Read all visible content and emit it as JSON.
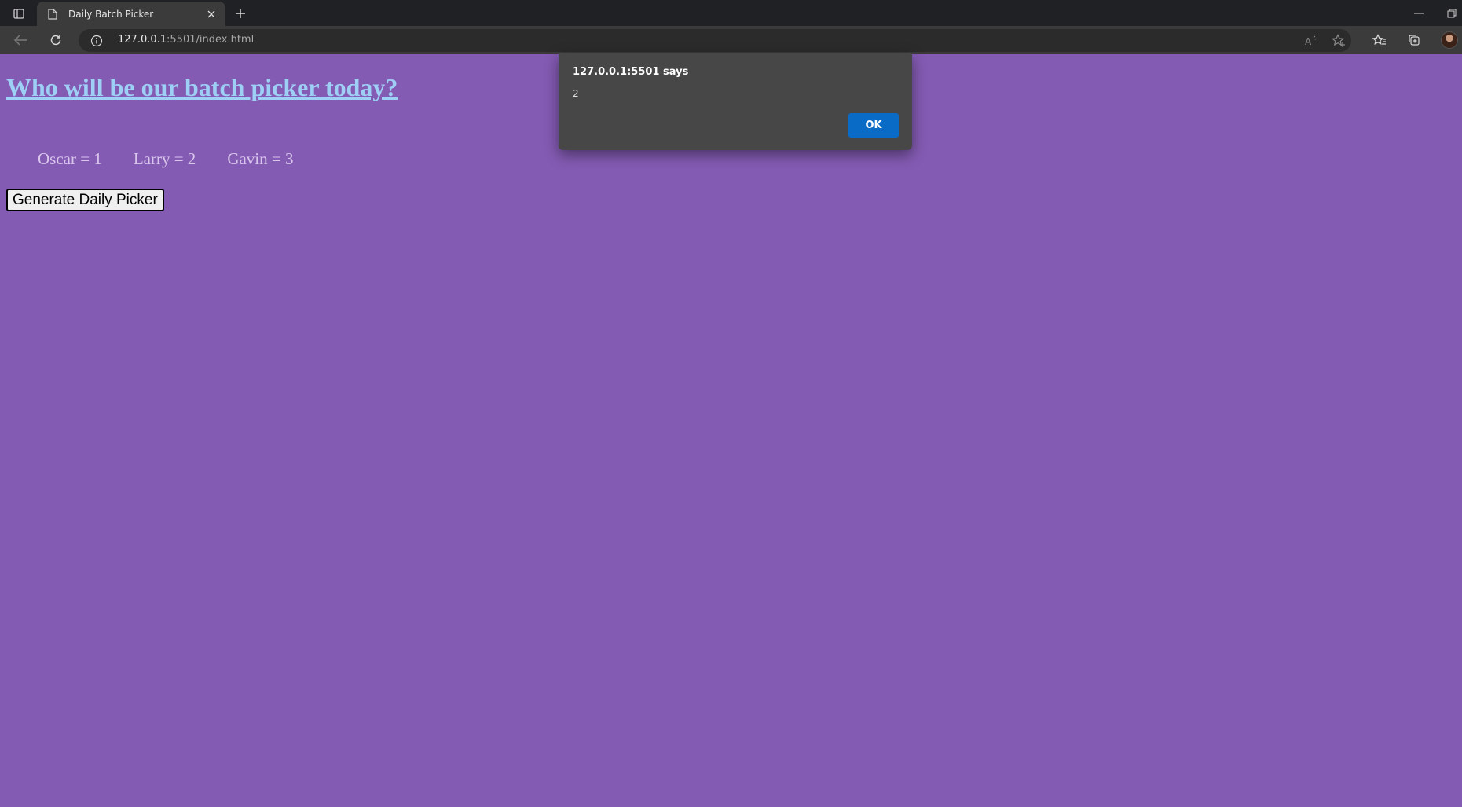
{
  "browser": {
    "tab": {
      "title": "Daily Batch Picker"
    },
    "address": {
      "host": "127.0.0.1",
      "rest": ":5501/index.html"
    },
    "icons": {
      "tab_actions": "tab-actions-icon",
      "page_favicon": "page-icon",
      "tab_close": "close-icon",
      "new_tab": "plus-icon",
      "minimize": "minimize-icon",
      "restore": "restore-icon",
      "back": "back-arrow-icon",
      "refresh": "refresh-icon",
      "site_info": "info-icon",
      "read_aloud": "read-aloud-icon",
      "add_favorite": "star-plus-icon",
      "favorites": "favorites-icon",
      "collections": "collections-icon",
      "profile": "avatar"
    }
  },
  "page": {
    "heading": "Who will be our batch picker today?",
    "names": [
      "Oscar = 1",
      "Larry = 2",
      "Gavin = 3"
    ],
    "button_label": "Generate Daily Picker",
    "colors": {
      "background": "#845bb3",
      "heading": "#9ecff5",
      "names": "#d9c6ec"
    }
  },
  "alert": {
    "title": "127.0.0.1:5501 says",
    "message": "2",
    "ok_label": "OK",
    "colors": {
      "ok_button": "#0a6bc7",
      "background": "#474747"
    }
  }
}
